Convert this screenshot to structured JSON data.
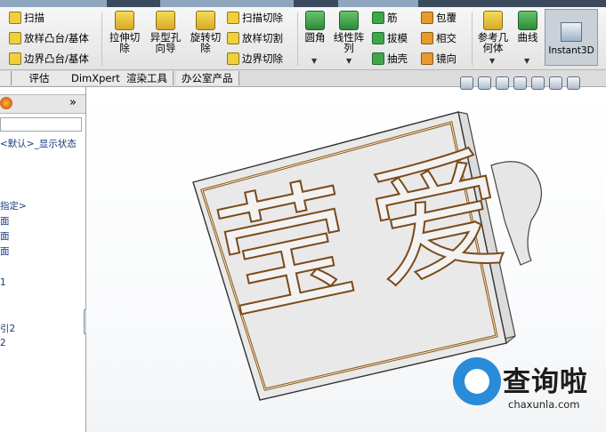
{
  "ribbon": {
    "small_col1": [
      "扫描",
      "放样凸台/基体",
      "边界凸台/基体"
    ],
    "big_buttons": [
      "拉伸切除",
      "异型孔向导",
      "旋转切除"
    ],
    "small_col2": [
      "扫描切除",
      "放样切割",
      "边界切除"
    ],
    "fillet": "圆角",
    "pattern": "线性阵列",
    "small_col3": [
      "筋",
      "拔模",
      "抽壳"
    ],
    "small_col4": [
      "包覆",
      "相交",
      "镜向"
    ],
    "ref_geometry": "参考几何体",
    "curves": "曲线",
    "instant3d": "Instant3D"
  },
  "tabs": [
    "评估",
    "DimXpert",
    "渲染工具",
    "办公室产品"
  ],
  "left_panel": {
    "collapse_glyph": "»",
    "tree_items": [
      "<默认>_显示状态",
      "指定>",
      "面",
      "面",
      "面",
      "1",
      "引2",
      "2"
    ]
  },
  "viewport": {
    "engraved_text": [
      "莹",
      "爱"
    ]
  },
  "watermark": {
    "brand": "查询啦",
    "url": "chaxunla.com",
    "brand_color": "#2a8bd8"
  }
}
